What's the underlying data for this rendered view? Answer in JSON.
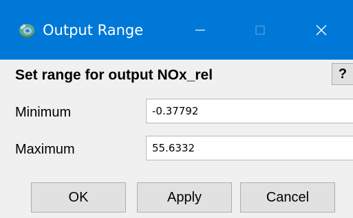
{
  "window": {
    "title": "Output Range",
    "controls": {
      "minimize": "minimize",
      "maximize": "maximize",
      "close": "close"
    },
    "accent_color": "#0078d7",
    "app_icon": "app-icon"
  },
  "dialog": {
    "heading": "Set range for output NOx_rel",
    "help_label": "?",
    "fields": {
      "minimum": {
        "label": "Minimum",
        "value": "-0.37792"
      },
      "maximum": {
        "label": "Maximum",
        "value": "55.6332"
      }
    },
    "buttons": {
      "ok": "OK",
      "apply": "Apply",
      "cancel": "Cancel"
    }
  }
}
